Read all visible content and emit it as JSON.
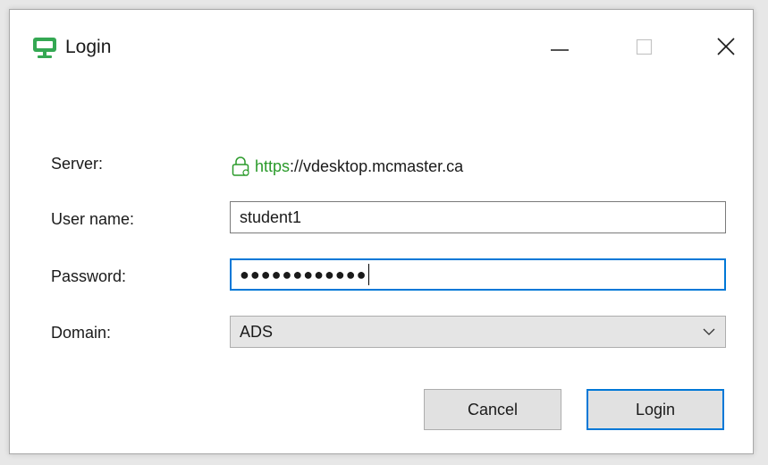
{
  "window": {
    "title": "Login"
  },
  "form": {
    "server_label": "Server:",
    "server_scheme": "https",
    "server_host": "://vdesktop.mcmaster.ca",
    "username_label": "User name:",
    "username_value": "student1",
    "password_label": "Password:",
    "password_mask": "●●●●●●●●●●●●",
    "domain_label": "Domain:",
    "domain_value": "ADS"
  },
  "buttons": {
    "cancel_label": "Cancel",
    "login_label": "Login"
  },
  "icons": {
    "app": "monitor-icon",
    "lock": "lock-icon",
    "minimize": "minimize-icon",
    "maximize": "maximize-icon",
    "close": "close-icon",
    "dropdown": "chevron-down-icon"
  },
  "colors": {
    "accent": "#0078d7",
    "secure_green": "#2a9a2a",
    "app_icon_green": "#34a853"
  }
}
